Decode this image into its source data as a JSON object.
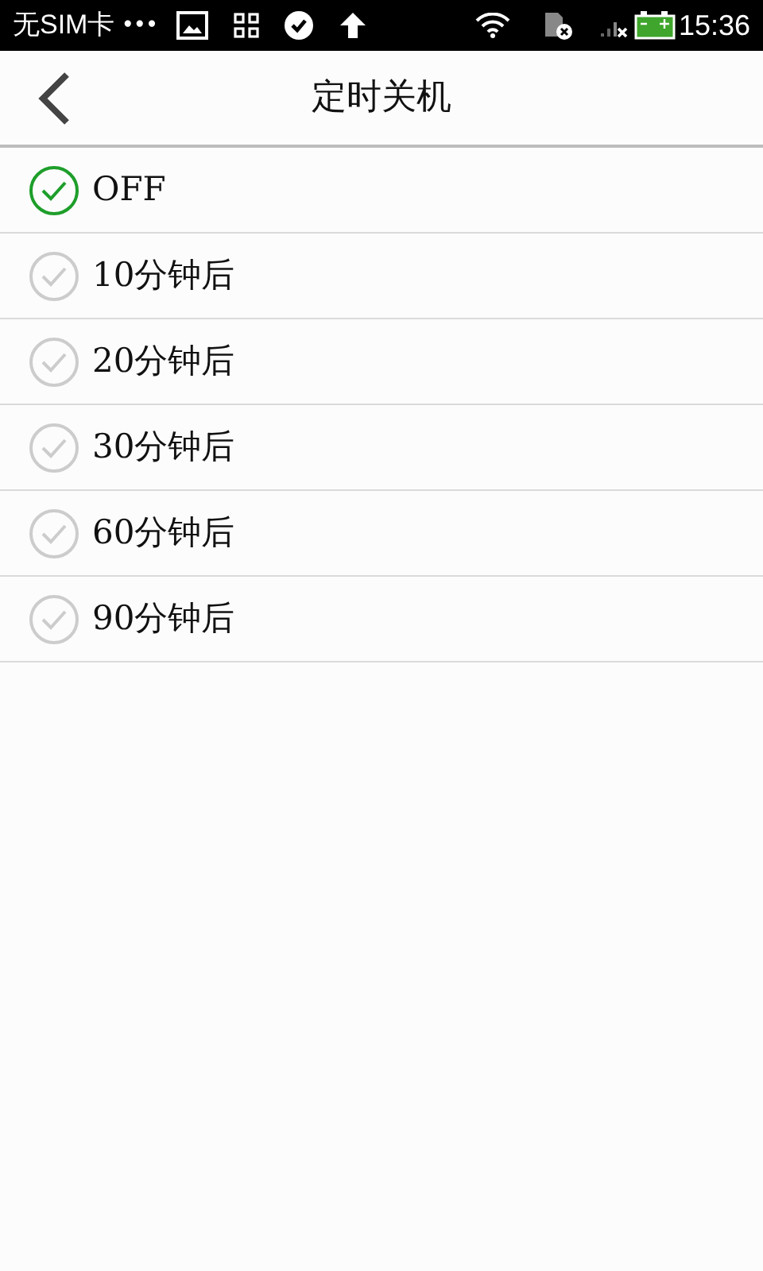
{
  "status_bar": {
    "carrier": "无SIM卡",
    "dots": "•••",
    "time": "15:36"
  },
  "header": {
    "title": "定时关机"
  },
  "options": [
    {
      "label": "OFF",
      "selected": true
    },
    {
      "label": "10分钟后",
      "selected": false
    },
    {
      "label": "20分钟后",
      "selected": false
    },
    {
      "label": "30分钟后",
      "selected": false
    },
    {
      "label": "60分钟后",
      "selected": false
    },
    {
      "label": "90分钟后",
      "selected": false
    }
  ]
}
